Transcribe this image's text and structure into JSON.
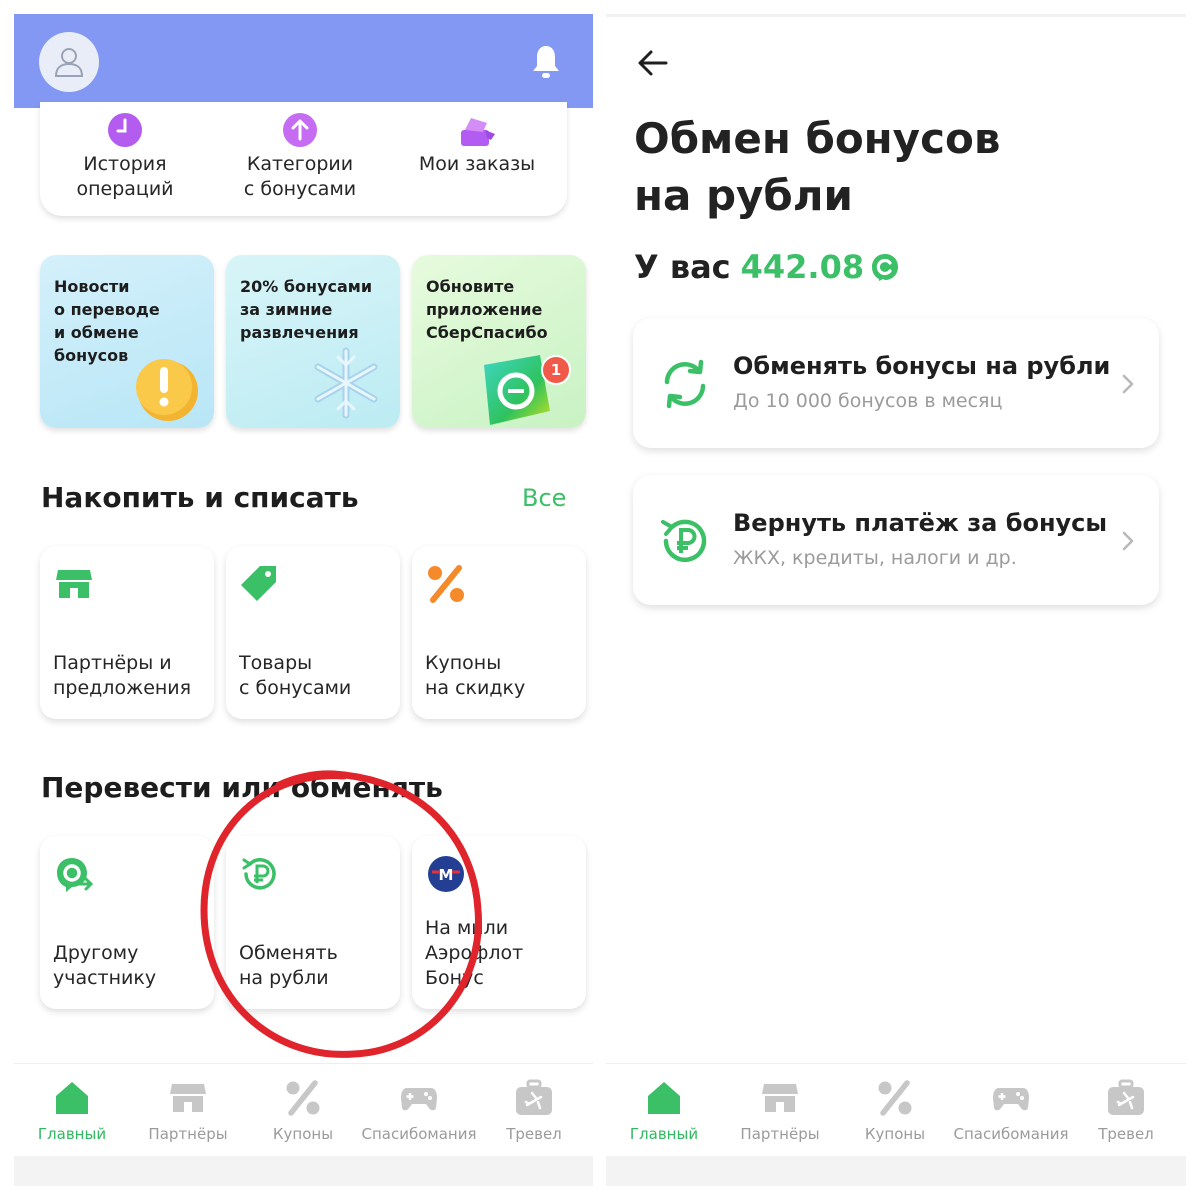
{
  "colors": {
    "accent_green": "#3bbf67",
    "header_blue": "#8298f2",
    "nav_inactive": "#9b9b9b",
    "annotation_red": "#e0242c"
  },
  "left": {
    "quick_actions": [
      {
        "label": "История\nопераций",
        "icon": "clock-icon"
      },
      {
        "label": "Категории\nс бонусами",
        "icon": "arrow-up-circle-icon"
      },
      {
        "label": "Мои заказы",
        "icon": "shopping-box-icon"
      }
    ],
    "stories": [
      {
        "text": "Новости\nо переводе\nи обмене бонусов",
        "icon": "exclamation-icon"
      },
      {
        "text": "20% бонусами\nза зимние\nразвлечения",
        "icon": "snowflake-icon"
      },
      {
        "text": "Обновите\nприложение\nСберСпасибо",
        "icon": "app-icon",
        "badge": "1"
      }
    ],
    "section_accumulate": {
      "title": "Накопить и списать",
      "all_link": "Все",
      "tiles": [
        {
          "label": "Партнёры и\nпредложения",
          "icon": "store-icon"
        },
        {
          "label": "Товары\nс бонусами",
          "icon": "tag-icon"
        },
        {
          "label": "Купоны\nна скидку",
          "icon": "percent-icon"
        }
      ]
    },
    "section_transfer": {
      "title": "Перевести или обменять",
      "tiles": [
        {
          "label": "Другому\nучастнику",
          "icon": "transfer-icon"
        },
        {
          "label": "Обменять\nна рубли",
          "icon": "ruble-exchange-icon"
        },
        {
          "label": "На мили\nАэрофлот\nБонус",
          "icon": "aeroflot-icon"
        }
      ]
    }
  },
  "nav": {
    "items": [
      {
        "label": "Главный",
        "icon": "home-icon",
        "active": true
      },
      {
        "label": "Партнёры",
        "icon": "store-icon",
        "active": false
      },
      {
        "label": "Купоны",
        "icon": "percent-icon",
        "active": false
      },
      {
        "label": "Спасибомания",
        "icon": "gamepad-icon",
        "active": false
      },
      {
        "label": "Тревел",
        "icon": "suitcase-plane-icon",
        "active": false
      }
    ]
  },
  "right": {
    "title": "Обмен бонусов\nна рубли",
    "balance_prefix": "У вас",
    "balance_value": "442.08",
    "actions": [
      {
        "title": "Обменять бонусы на рубли",
        "subtitle": "До 10 000 бонусов в месяц",
        "icon": "refresh-arrows-icon"
      },
      {
        "title": "Вернуть платёж за бонусы",
        "subtitle": "ЖКХ, кредиты, налоги и др.",
        "icon": "ruble-return-icon"
      }
    ]
  }
}
